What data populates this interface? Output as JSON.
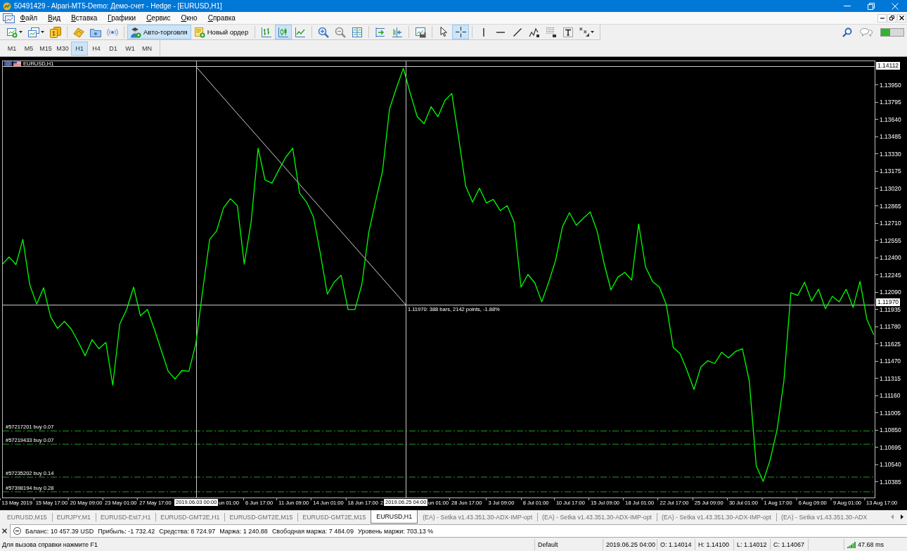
{
  "window": {
    "title": "50491429 - Alpari-MT5-Demo: Демо-счет - Hedge - [EURUSD,H1]"
  },
  "menu": [
    "Файл",
    "Вид",
    "Вставка",
    "Графики",
    "Сервис",
    "Окно",
    "Справка"
  ],
  "toolbar": {
    "groups": [
      [
        {
          "on": false,
          "menu": true
        },
        {
          "on": false,
          "menu": true
        },
        {
          "on": false
        }
      ],
      [
        {
          "on": false
        },
        {
          "on": false
        },
        {
          "on": false
        }
      ],
      [
        {
          "label": "Авто-торговля",
          "on": true
        },
        {
          "label": "Новый ордер",
          "on": false
        }
      ],
      [
        {
          "on": false
        },
        {
          "on": true
        },
        {
          "on": false
        }
      ],
      [
        {
          "on": false
        },
        {
          "on": false
        },
        {
          "on": false
        }
      ],
      [
        {
          "on": false
        },
        {
          "on": false
        }
      ],
      [
        {
          "on": false
        }
      ],
      [
        {
          "on": false
        },
        {
          "on": true
        }
      ],
      [
        {
          "on": false
        },
        {
          "on": false
        },
        {
          "on": false
        },
        {
          "on": false
        },
        {
          "on": false
        },
        {
          "on": false
        },
        {
          "on": false,
          "menu": true
        }
      ]
    ]
  },
  "timeframes": [
    {
      "label": "M1",
      "selected": false
    },
    {
      "label": "M5",
      "selected": false
    },
    {
      "label": "M15",
      "selected": false
    },
    {
      "label": "M30",
      "selected": false
    },
    {
      "label": "H1",
      "selected": true
    },
    {
      "label": "H4",
      "selected": false
    },
    {
      "label": "D1",
      "selected": false
    },
    {
      "label": "W1",
      "selected": false
    },
    {
      "label": "MN",
      "selected": false
    }
  ],
  "chart": {
    "symbol": "EURUSD,H1",
    "chart_data": [
      {
        "type": "line",
        "color": "#00ff00",
        "ylim": [
          1.10245,
          1.14164
        ],
        "yticks": [
          {
            "value": 1.1395,
            "label": "1.13950"
          },
          {
            "value": 1.13795,
            "label": "1.13795"
          },
          {
            "value": 1.1364,
            "label": "1.13640"
          },
          {
            "value": 1.13485,
            "label": "1.13485"
          },
          {
            "value": 1.1333,
            "label": "1.13330"
          },
          {
            "value": 1.13175,
            "label": "1.13175"
          },
          {
            "value": 1.1302,
            "label": "1.13020"
          },
          {
            "value": 1.12865,
            "label": "1.12865"
          },
          {
            "value": 1.1271,
            "label": "1.12710"
          },
          {
            "value": 1.12555,
            "label": "1.12555"
          },
          {
            "value": 1.124,
            "label": "1.12400"
          },
          {
            "value": 1.12245,
            "label": "1.12245"
          },
          {
            "value": 1.1209,
            "label": "1.12090"
          },
          {
            "value": 1.11935,
            "label": "1.11935"
          },
          {
            "value": 1.1178,
            "label": "1.11780"
          },
          {
            "value": 1.11625,
            "label": "1.11625"
          },
          {
            "value": 1.1147,
            "label": "1.11470"
          },
          {
            "value": 1.11315,
            "label": "1.11315"
          },
          {
            "value": 1.1116,
            "label": "1.11160"
          },
          {
            "value": 1.11005,
            "label": "1.11005"
          },
          {
            "value": 1.1085,
            "label": "1.10850"
          },
          {
            "value": 1.10695,
            "label": "1.10695"
          },
          {
            "value": 1.1054,
            "label": "1.10540"
          },
          {
            "value": 1.10385,
            "label": "1.10385"
          }
        ],
        "categories": [
          null,
          null,
          "13 May 2019",
          null,
          null,
          null,
          null,
          "15 May 17:00",
          null,
          null,
          null,
          null,
          "20 May 09:00",
          null,
          null,
          null,
          null,
          "23 May 01:00",
          null,
          null,
          null,
          null,
          "27 May 17:00",
          null,
          null,
          null,
          null,
          null,
          null,
          null,
          null,
          null,
          null,
          null,
          null,
          null,
          null,
          "6 Jun 17:00",
          null,
          null,
          null,
          null,
          "11 Jun 09:00",
          null,
          null,
          null,
          null,
          "14 Jun 01:00",
          null,
          null,
          null,
          null,
          "18 Jun 17:00",
          null,
          null,
          null,
          null,
          null,
          null,
          null,
          null,
          null,
          null,
          null,
          null,
          null,
          null,
          "28 Jun 17:00",
          null,
          null,
          null,
          null,
          "3 Jul 09:00",
          null,
          null,
          null,
          null,
          "8 Jul 01:00",
          null,
          null,
          null,
          null,
          "10 Jul 17:00",
          null,
          null,
          null,
          null,
          "15 Jul 09:00",
          null,
          null,
          null,
          null,
          "18 Jul 01:00",
          null,
          null,
          null,
          null,
          "22 Jul 17:00",
          null,
          null,
          null,
          null,
          "25 Jul 09:00",
          null,
          null,
          null,
          null,
          "30 Jul 01:00",
          null,
          null,
          null,
          null,
          "1 Aug 17:00",
          null,
          null,
          null,
          null,
          "6 Aug 09:00",
          null,
          null,
          null,
          null,
          "9 Aug 01:00",
          null,
          null,
          null,
          null,
          "13 Aug 17:00"
        ],
        "values": [
          1.12343,
          1.12406,
          1.12337,
          1.12564,
          1.12154,
          1.11984,
          1.12129,
          1.11871,
          1.11764,
          1.11827,
          1.11757,
          1.11644,
          1.11518,
          1.11663,
          1.11581,
          1.11638,
          1.11253,
          1.11801,
          1.11934,
          1.12135,
          1.11877,
          1.11934,
          1.11757,
          1.11568,
          1.11379,
          1.1131,
          1.11386,
          1.11379,
          1.11625,
          1.1211,
          1.12564,
          1.12639,
          1.12847,
          1.12929,
          1.12866,
          1.12343,
          1.12721,
          1.13383,
          1.13099,
          1.13068,
          1.13188,
          1.13301,
          1.13383,
          1.1298,
          1.12898,
          1.12765,
          1.12438,
          1.12072,
          1.12179,
          1.12242,
          1.11934,
          1.11934,
          1.1216,
          1.12627,
          1.1291,
          1.13181,
          1.13736,
          1.13925,
          1.141,
          1.13874,
          1.13666,
          1.13603,
          1.13755,
          1.13666,
          1.13811,
          1.13874,
          1.13471,
          1.13043,
          1.12898,
          1.13024,
          1.12891,
          1.12923,
          1.12822,
          1.12866,
          1.12721,
          1.12135,
          1.12249,
          1.12173,
          1.12003,
          1.12179,
          1.12375,
          1.12677,
          1.12803,
          1.1269,
          1.12753,
          1.1281,
          1.12639,
          1.1235,
          1.1211,
          1.12224,
          1.12268,
          1.12198,
          1.12702,
          1.12318,
          1.12186,
          1.12135,
          1.11978,
          1.11593,
          1.11537,
          1.11386,
          1.11215,
          1.11417,
          1.11474,
          1.11449,
          1.11549,
          1.11499,
          1.11556,
          1.11581,
          1.11291,
          1.10529,
          1.1039,
          1.10579,
          1.1085,
          1.11291,
          1.12085,
          1.1206,
          1.12179,
          1.12009,
          1.12116,
          1.1194,
          1.12053,
          1.12003,
          1.12116,
          1.11953,
          1.12186,
          1.11845,
          1.11707,
          null
        ],
        "ref_lines": [
          {
            "axis": "y",
            "value": 1.10843,
            "label": "#57217201 buy 0.07",
            "color": "#1f9c1f",
            "line_style": "dashdot"
          },
          {
            "axis": "y",
            "value": 1.10724,
            "label": "#57219433 buy 0.07",
            "color": "#1f9c1f",
            "line_style": "dashdot"
          },
          {
            "axis": "y",
            "value": 1.10428,
            "label": "#57235202 buy 0.14",
            "color": "#1f9c1f",
            "line_style": "dashdot"
          },
          {
            "axis": "y",
            "value": 1.10296,
            "label": "#57398194 buy 0.28",
            "color": "#1f9c1f",
            "line_style": "dashdot"
          }
        ]
      }
    ],
    "crosshair": {
      "price_labels": [
        "1.14112",
        "1.11970"
      ],
      "time_labels": [
        "2019.06.03 00:00",
        "2019.06.25 04:00"
      ],
      "covered_time_labels": [
        "un 01:00",
        "2",
        "un 01:00"
      ],
      "ruler_label": "1.11970: 388 bars, 2142 points, -1.88%"
    }
  },
  "chart_tabs": [
    {
      "label": "EURUSD,M15",
      "selected": false
    },
    {
      "label": "EURJPY,M1",
      "selected": false
    },
    {
      "label": "EURUSD-Est7,H1",
      "selected": false
    },
    {
      "label": "EURUSD-GMT2E,H1",
      "selected": false
    },
    {
      "label": "EURUSD-GMT2E,M15",
      "selected": false
    },
    {
      "label": "EURUSD-GMT2E,M15",
      "selected": false
    },
    {
      "label": "EURUSD,H1",
      "selected": true
    },
    {
      "label": "(EA) - Setka v1.43.351.30-ADX-IMP-opt",
      "selected": false
    },
    {
      "label": "(EA) - Setka v1.43.351.30-ADX-IMP-opt",
      "selected": false
    },
    {
      "label": "(EA) - Setka v1.43.351.30-ADX-IMP-opt",
      "selected": false
    },
    {
      "label": "(EA) - Setka v1.43.351.30-ADX",
      "selected": false
    }
  ],
  "account": [
    "Баланс: 10 457.39 USD",
    "Прибыль: -1 732.42",
    "Средства: 8 724.97",
    "Маржа: 1 240.88",
    "Свободная маржа: 7 484.09",
    "Уровень маржи: 703.13 %"
  ],
  "status_bar": {
    "help": "Для вызова справки нажмите F1",
    "profile": "Default",
    "bar_time": "2019.06.25 04:00",
    "ohlc": [
      "O: 1.14014",
      "H: 1.14100",
      "L: 1.14012",
      "C: 1.14067"
    ],
    "ping": "47.68 ms"
  }
}
